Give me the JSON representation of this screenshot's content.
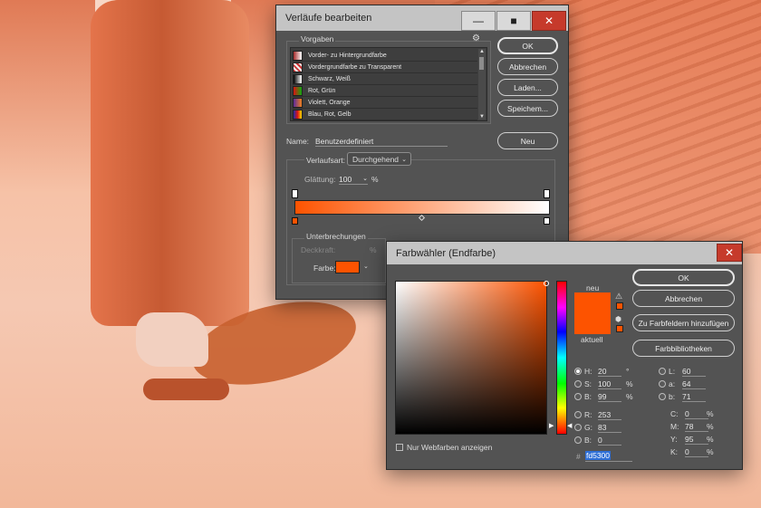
{
  "gradient_editor": {
    "title": "Verläufe bearbeiten",
    "presets_label": "Vorgaben",
    "presets": [
      {
        "label": "Vorder- zu Hintergrundfarbe",
        "swatch": "linear-gradient(90deg,#a52a2a,#fff)"
      },
      {
        "label": "Vordergrundfarbe zu Transparent",
        "swatch": "repeating-linear-gradient(45deg,#c33 0 2px,#eee 2px 4px)"
      },
      {
        "label": "Schwarz, Weiß",
        "swatch": "linear-gradient(90deg,#000,#fff)"
      },
      {
        "label": "Rot, Grün",
        "swatch": "linear-gradient(90deg,#d11,#1a1)"
      },
      {
        "label": "Violett, Orange",
        "swatch": "linear-gradient(90deg,#5b2a9a,#f08020)"
      },
      {
        "label": "Blau, Rot, Gelb",
        "swatch": "linear-gradient(90deg,#1d2eb0,#d11,#ffe000)"
      }
    ],
    "buttons": {
      "ok": "OK",
      "cancel": "Abbrechen",
      "load": "Laden...",
      "save": "Speichem...",
      "new": "Neu"
    },
    "name_label": "Name:",
    "name_value": "Benutzerdefiniert",
    "type_label": "Verlaufsart:",
    "type_value": "Durchgehend",
    "smoothness_label": "Glättung:",
    "smoothness_value": "100",
    "smoothness_unit": "%",
    "stops_label": "Unterbrechungen",
    "opacity_label": "Deckkraft:",
    "opacity_unit": "%",
    "color_label": "Farbe:",
    "gradient_start": "#fd5300",
    "gradient_end": "#ffffff"
  },
  "color_picker": {
    "title": "Farbwähler (Endfarbe)",
    "new_label": "neu",
    "current_label": "aktuell",
    "new_color": "#fd5300",
    "current_color": "#fd5300",
    "buttons": {
      "ok": "OK",
      "cancel": "Abbrechen",
      "add_swatches": "Zu Farbfeldern hinzufügen",
      "libraries": "Farbbibliotheken"
    },
    "web_colors_label": "Nur Webfarben anzeigen",
    "hsb": [
      {
        "key": "H:",
        "value": "20",
        "unit": "°",
        "selected": true
      },
      {
        "key": "S:",
        "value": "100",
        "unit": "%",
        "selected": false
      },
      {
        "key": "B:",
        "value": "99",
        "unit": "%",
        "selected": false
      }
    ],
    "rgb": [
      {
        "key": "R:",
        "value": "253"
      },
      {
        "key": "G:",
        "value": "83"
      },
      {
        "key": "B:",
        "value": "0"
      }
    ],
    "lab": [
      {
        "key": "L:",
        "value": "60"
      },
      {
        "key": "a:",
        "value": "64"
      },
      {
        "key": "b:",
        "value": "71"
      }
    ],
    "cmyk": [
      {
        "key": "C:",
        "value": "0",
        "unit": "%"
      },
      {
        "key": "M:",
        "value": "78",
        "unit": "%"
      },
      {
        "key": "Y:",
        "value": "95",
        "unit": "%"
      },
      {
        "key": "K:",
        "value": "0",
        "unit": "%"
      }
    ],
    "hex_label": "#",
    "hex_value": "fd5300"
  }
}
